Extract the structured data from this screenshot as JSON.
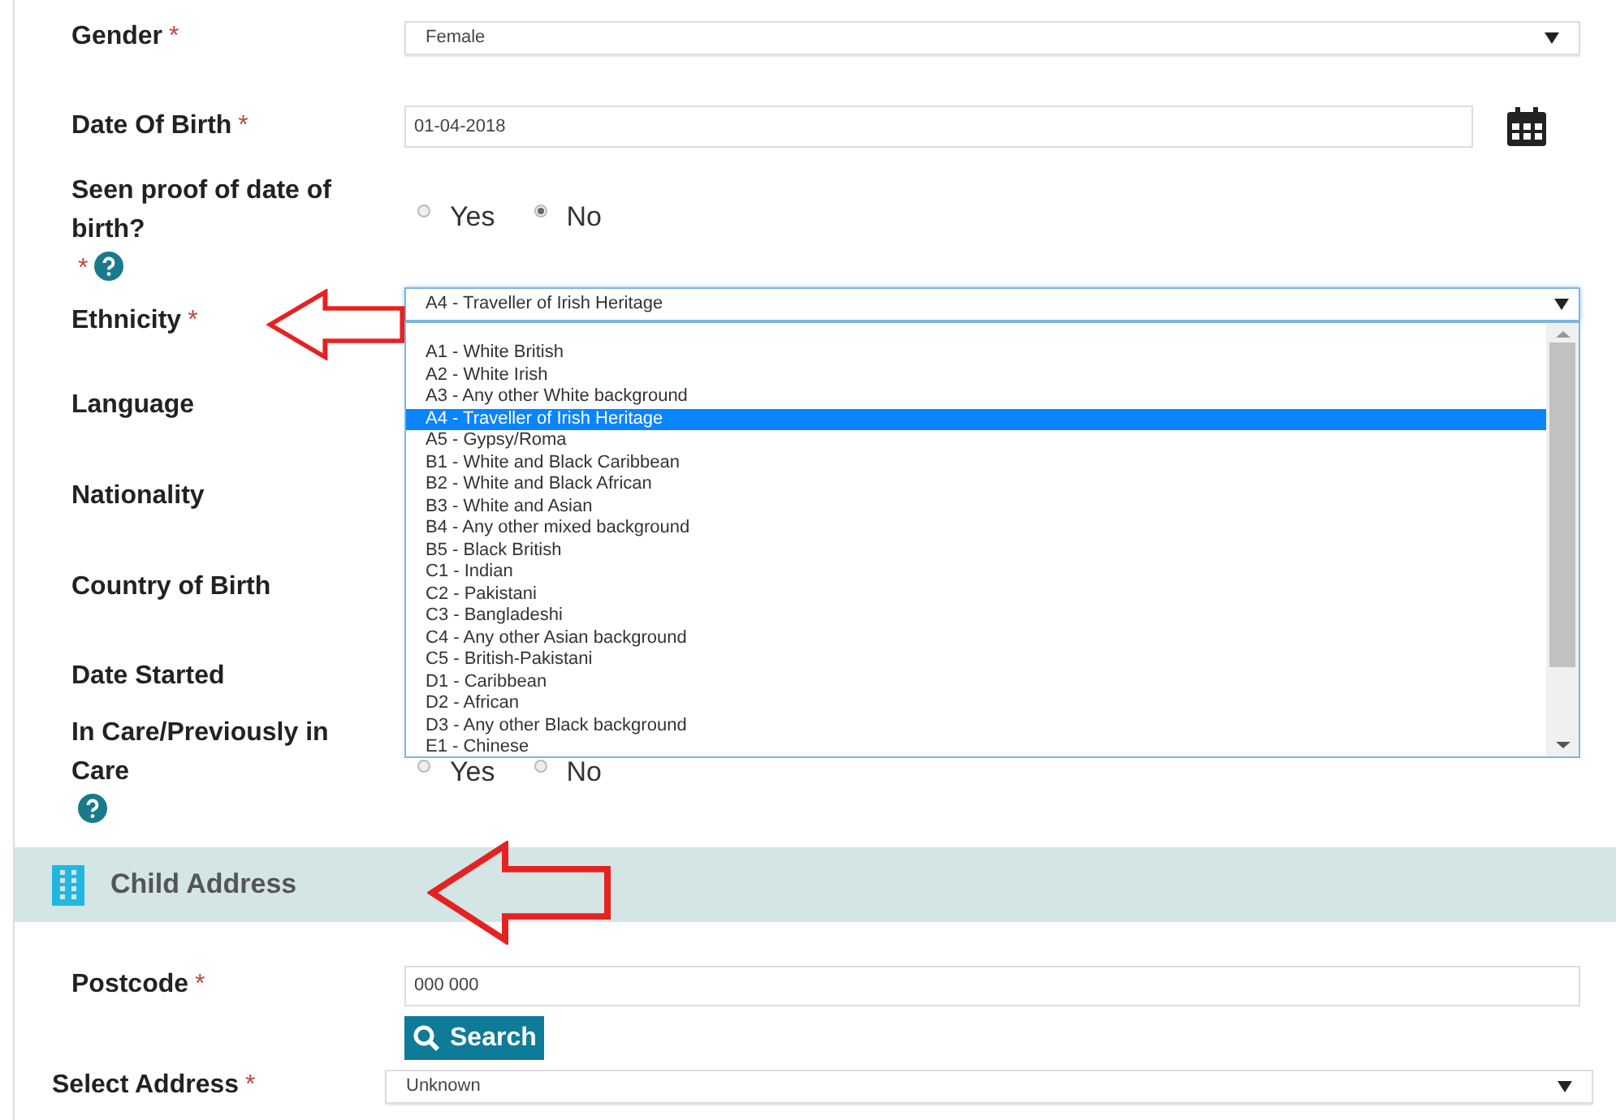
{
  "fields": [
    {
      "label": "Gender",
      "mark": "*",
      "kind": "select",
      "value": "Female"
    },
    {
      "label": "Date Of Birth",
      "mark": "*",
      "kind": "date",
      "value": "01-04-2018"
    },
    {
      "label": "Seen proof of date of birth?",
      "mark": "*",
      "help": true,
      "kind": "radio",
      "options": [
        {
          "label": "Yes",
          "selected": false
        },
        {
          "label": "No",
          "selected": true
        }
      ]
    },
    {
      "label": "Ethnicity",
      "mark": "*",
      "kind": "dropdown",
      "value": "A4 - Traveller of Irish Heritage",
      "open": true,
      "options": [
        {
          "label": "A1 - White British",
          "selected": false
        },
        {
          "label": "A2 - White Irish",
          "selected": false
        },
        {
          "label": "A3 - Any other White background",
          "selected": false
        },
        {
          "label": "A4 - Traveller of Irish Heritage",
          "selected": true
        },
        {
          "label": "A5 - Gypsy/Roma",
          "selected": false
        },
        {
          "label": "B1 - White and Black Caribbean",
          "selected": false
        },
        {
          "label": "B2 - White and Black African",
          "selected": false
        },
        {
          "label": "B3 - White and Asian",
          "selected": false
        },
        {
          "label": "B4 - Any other mixed background",
          "selected": false
        },
        {
          "label": "B5 - Black British",
          "selected": false
        },
        {
          "label": "C1 - Indian",
          "selected": false
        },
        {
          "label": "C2 - Pakistani",
          "selected": false
        },
        {
          "label": "C3 - Bangladeshi",
          "selected": false
        },
        {
          "label": "C4 - Any other Asian background",
          "selected": false
        },
        {
          "label": "C5 - British-Pakistani",
          "selected": false
        },
        {
          "label": "D1 - Caribbean",
          "selected": false
        },
        {
          "label": "D2 - African",
          "selected": false
        },
        {
          "label": "D3 - Any other Black background",
          "selected": false
        },
        {
          "label": "E1 - Chinese",
          "selected": false
        }
      ]
    },
    {
      "label": "Language",
      "kind": "hidden"
    },
    {
      "label": "Nationality",
      "kind": "hidden"
    },
    {
      "label": "Country of Birth",
      "kind": "hidden"
    },
    {
      "label": "Date Started",
      "kind": "hidden"
    },
    {
      "label": "In Care/Previously in Care",
      "help": true,
      "kind": "radio",
      "options": [
        {
          "label": "Yes",
          "selected": false
        },
        {
          "label": "No",
          "selected": false
        }
      ]
    }
  ],
  "section": {
    "title": "Child Address"
  },
  "address_fields": [
    {
      "label": "Postcode",
      "mark": "*",
      "kind": "text",
      "value": "000 000",
      "button": "Search"
    },
    {
      "label": "Select Address",
      "mark": "*",
      "kind": "select",
      "value": "Unknown"
    }
  ]
}
